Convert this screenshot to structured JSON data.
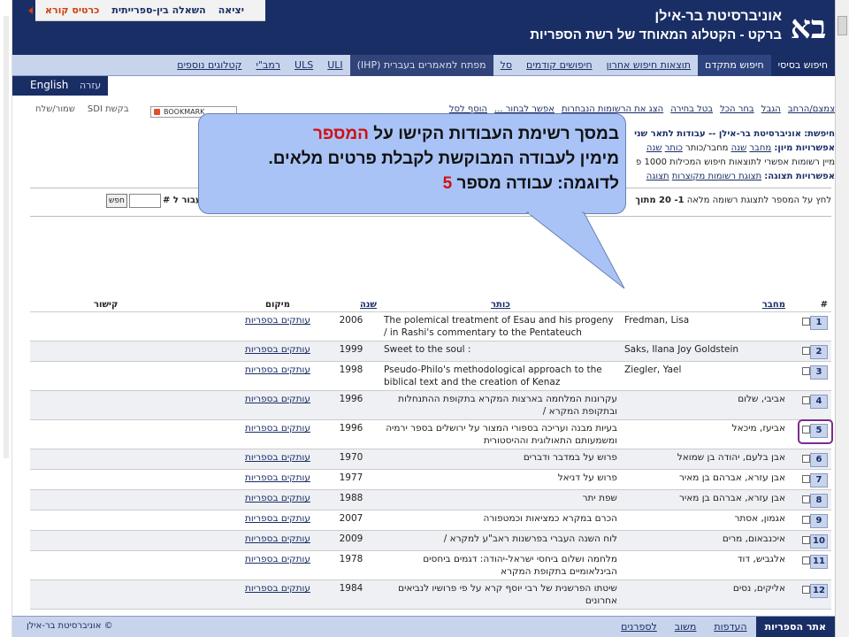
{
  "header": {
    "logo_text": "בא",
    "university": "אוניברסיטת בר-אילן",
    "catalog_title": "ברקט - הקטלוג המאוחד של רשת הספריות",
    "top_links": [
      "כרטיס קורא",
      "השאלה בין-ספרייתית",
      "יציאה"
    ]
  },
  "nav": {
    "tabs": [
      "חיפוש בסיסי",
      "חיפוש מתקדם",
      "תוצאות חיפוש אחרון",
      "חיפושים קודמים",
      "סל",
      "מפתח למאמרים בעברית (IHP)",
      "ULI",
      "ULS",
      "רמב\"י",
      "קטלוגים נוספים"
    ]
  },
  "lang": {
    "help": "עזרה",
    "english": "English"
  },
  "toolbar": {
    "actions": [
      "צמצם/הרחב",
      "הגבל",
      "בחר הכל",
      "בטל בחירה",
      "הצג את הרשומות הנבחרות",
      "אפשר לבחור ...",
      "הוסף לסל"
    ],
    "sdi": "בקשת SDI",
    "save_send": "שמור/שלח",
    "bookmark": "BOOKMARK"
  },
  "search_info": {
    "searched_label": "חיפשת:",
    "searched_value": "אוניברסיטת בר-אילן -- עבודות לתאר שני",
    "sort_label": "אפשרויות מיון:",
    "sort_options": [
      "מחבר",
      "שנה",
      "מחבר/כותר",
      "כותר",
      "שנה"
    ],
    "limit_note": "מיין רשומות אפשרי לתוצאות חיפוש המכילות 1000 פ",
    "display_label": "אפשרויות תצוגה:",
    "display_options": [
      "תצוגת רשומות מקוצרות",
      "תצוגה"
    ]
  },
  "jump": {
    "hint": "לחץ על המספר לתצוגת רשומה מלאה",
    "range": "1- 20 מתוך",
    "label": "עבור ל #",
    "go": "חפש"
  },
  "table": {
    "headers": {
      "num": "#",
      "author": "מחבר",
      "title": "כותר",
      "year": "שנה",
      "location": "מיקום",
      "link": "קישור"
    },
    "rows": [
      {
        "num": "1",
        "author": "Fredman, Lisa",
        "title": "The polemical treatment of Esau and his progeny / in Rashi's commentary to the Pentateuch",
        "year": "2006",
        "location": "עותקים בספריות"
      },
      {
        "num": "2",
        "author": "Saks, Ilana Joy Goldstein",
        "title": "Sweet to the soul :",
        "year": "1999",
        "location": "עותקים בספריות"
      },
      {
        "num": "3",
        "author": "Ziegler, Yael",
        "title": "Pseudo-Philo's methodological approach to the biblical text and the creation of Kenaz",
        "year": "1998",
        "location": "עותקים בספריות"
      },
      {
        "num": "4",
        "author": "אביבי, שלום",
        "title": "עקרונות המלחמה בארצות המקרא בתקופת ההתנחלות ובתקופת המקרא /",
        "year": "1996",
        "location": "עותקים בספריות"
      },
      {
        "num": "5",
        "author": "אביעז, מיכאל",
        "title": "בעיות מבנה ועריכה בספורי המצור על ירושלים בספר ירמיה ומשמעותם התאולוגית וההיסטורית",
        "year": "1996",
        "location": "עותקים בספריות"
      },
      {
        "num": "6",
        "author": "אבן בלעם, יהודה בן שמואל",
        "title": "פרוש על במדבר ודברים",
        "year": "1970",
        "location": "עותקים בספריות"
      },
      {
        "num": "7",
        "author": "אבן עזרא, אברהם בן מאיר",
        "title": "פרוש על דניאל",
        "year": "1977",
        "location": "עותקים בספריות"
      },
      {
        "num": "8",
        "author": "אבן עזרא, אברהם בן מאיר",
        "title": "שפת יתר",
        "year": "1988",
        "location": "עותקים בספריות"
      },
      {
        "num": "9",
        "author": "אגמון, אסתר",
        "title": "הכרם במקרא כמציאות וכמטפורה",
        "year": "2007",
        "location": "עותקים בספריות"
      },
      {
        "num": "10",
        "author": "איכנבאום, מרים",
        "title": "לוח השנה העברי בפרשנות ראב\"ע למקרא /",
        "year": "2009",
        "location": "עותקים בספריות"
      },
      {
        "num": "11",
        "author": "אלגביש, דוד",
        "title": "מלחמה ושלום ביחסי ישראל-יהודה: דגמים ביחסים הבינלאומיים בתקופת המקרא",
        "year": "1978",
        "location": "עותקים בספריות"
      },
      {
        "num": "12",
        "author": "אליקים, נסים",
        "title": "שיטתו הפרשנית של רבי יוסף קרא על פי פרושיו לנביאים אחרונים",
        "year": "1984",
        "location": "עותקים בספריות"
      }
    ]
  },
  "callout": {
    "line1_a": "במסך רשימת העבודות הקישו על ",
    "line1_red": "המספר",
    "line2": "מימין לעבודה המבוקשת לקבלת פרטים מלאים.",
    "line3_a": "לדוגמה: עבודה מספר ",
    "line3_red": "5"
  },
  "footer": {
    "tabs": [
      "אתר הספריות",
      "העדפות",
      "משוב",
      "לספרנים"
    ],
    "copyright": "© אוניברסיטת בר-אילן"
  },
  "colors": {
    "brand": "#1a2e66",
    "nav_bg": "#c8d4ec",
    "highlight": "#7a2d8c",
    "callout_bg": "#a9c3f6",
    "accent_red": "#d01010"
  }
}
